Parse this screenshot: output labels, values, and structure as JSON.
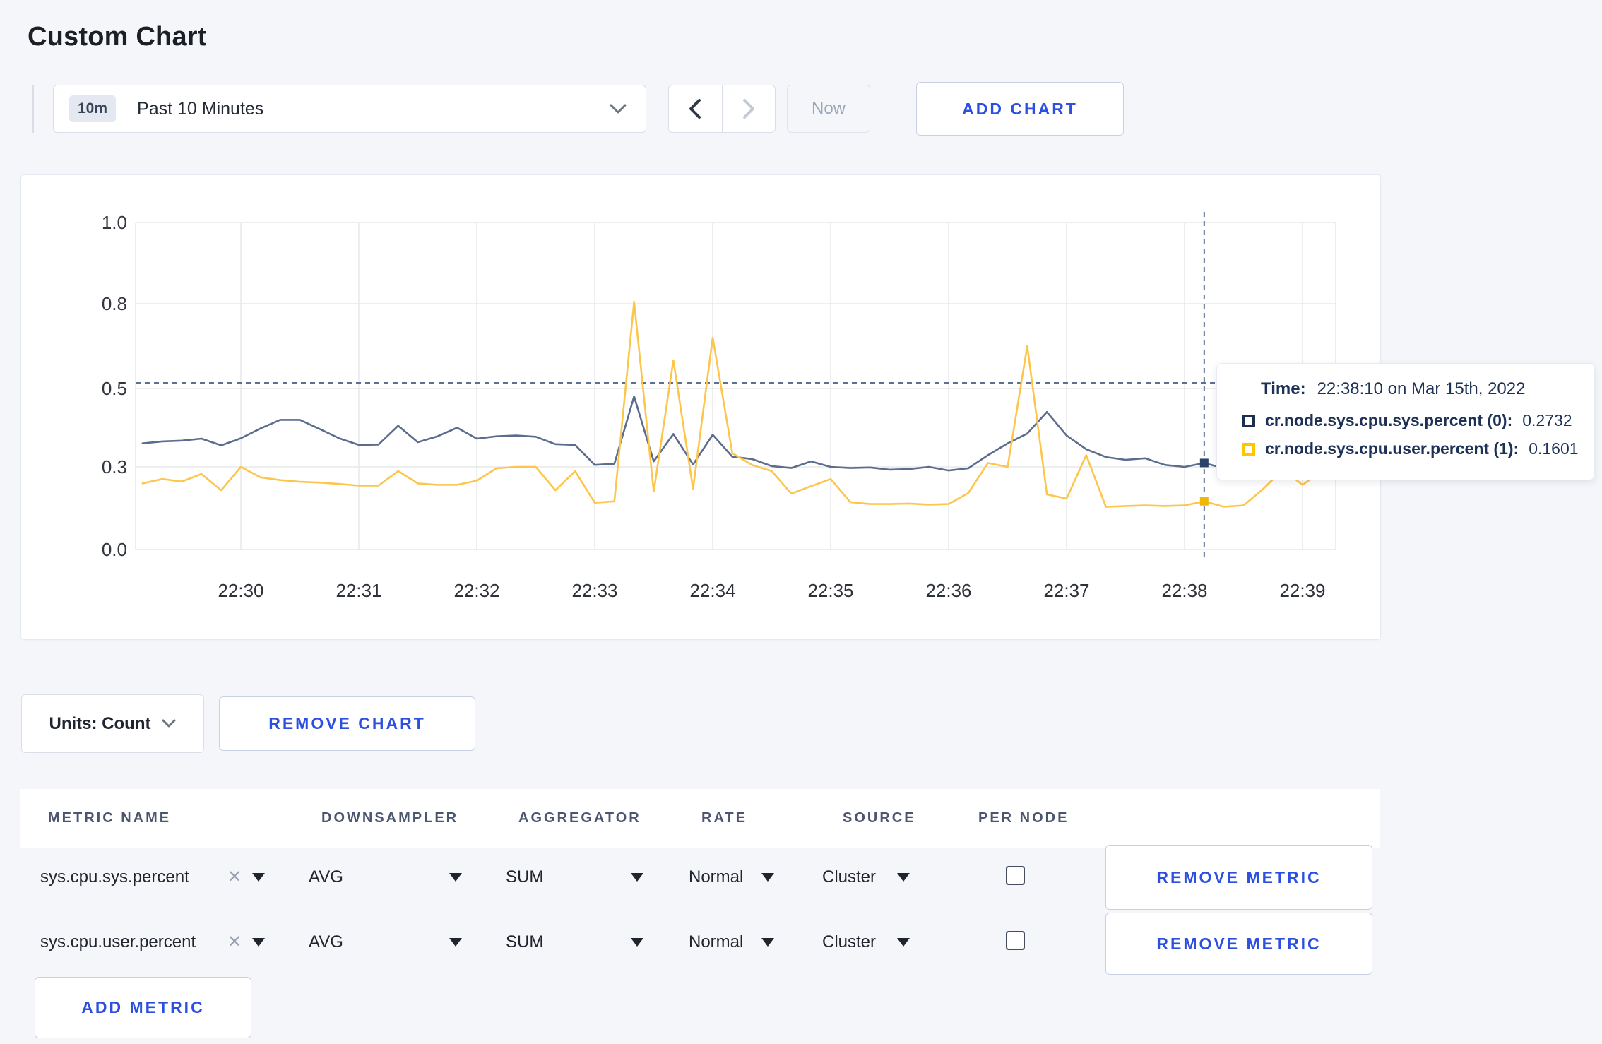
{
  "page": {
    "title": "Custom Chart"
  },
  "colors": {
    "accent_blue": "#2c4fe0",
    "page_background": "#f5f6fa",
    "gridline": "#e7e8ec",
    "crosshair": "#5c7191",
    "axis_text": "#33373f",
    "series_sys_line": "#5b6c8f",
    "series_user_line": "#fdc64b",
    "tooltip_sys_swatch": "#1c2e52",
    "tooltip_user_swatch": "#ffc600"
  },
  "toolbar": {
    "time_selector": {
      "badge": "10m",
      "label": "Past 10 Minutes"
    },
    "prev_icon": "chevron-left",
    "next_icon": "chevron-right",
    "now_label": "Now",
    "add_chart_label": "ADD CHART"
  },
  "chart_data": {
    "type": "line",
    "title": "",
    "xlabel": "",
    "ylabel": "",
    "x_start_time": "22:29:10",
    "x_step_seconds": 10,
    "x_tick_labels": [
      "22:30",
      "22:31",
      "22:32",
      "22:33",
      "22:34",
      "22:35",
      "22:36",
      "22:37",
      "22:38",
      "22:39"
    ],
    "y_tick_labels": [
      "0.0",
      "0.3",
      "0.5",
      "0.8",
      "1.0"
    ],
    "y_tick_values": [
      0.0,
      0.3,
      0.5,
      0.8,
      1.0
    ],
    "grid": true,
    "legend_position": "none",
    "series": [
      {
        "name": "cr.node.sys.cpu.sys.percent (0)",
        "color": "#5b6c8f",
        "values": [
          0.36,
          0.365,
          0.367,
          0.372,
          0.355,
          0.373,
          0.398,
          0.42,
          0.42,
          0.397,
          0.373,
          0.356,
          0.357,
          0.405,
          0.363,
          0.378,
          0.4,
          0.372,
          0.378,
          0.38,
          0.377,
          0.358,
          0.356,
          0.305,
          0.308,
          0.48,
          0.314,
          0.384,
          0.306,
          0.382,
          0.326,
          0.32,
          0.302,
          0.296,
          0.314,
          0.3,
          0.296,
          0.298,
          0.29,
          0.292,
          0.3,
          0.287,
          0.295,
          0.33,
          0.36,
          0.385,
          0.44,
          0.38,
          0.345,
          0.325,
          0.318,
          0.322,
          0.305,
          0.3,
          0.31,
          0.295,
          0.3,
          0.29,
          0.3,
          0.295,
          0.3
        ]
      },
      {
        "name": "cr.node.sys.cpu.user.percent (1)",
        "color": "#fdc64b",
        "values": [
          0.24,
          0.256,
          0.247,
          0.274,
          0.215,
          0.3,
          0.262,
          0.252,
          0.246,
          0.243,
          0.238,
          0.232,
          0.232,
          0.285,
          0.24,
          0.235,
          0.235,
          0.25,
          0.295,
          0.3,
          0.3,
          0.215,
          0.285,
          0.17,
          0.175,
          0.805,
          0.21,
          0.6,
          0.22,
          0.68,
          0.335,
          0.305,
          0.285,
          0.203,
          0.23,
          0.256,
          0.172,
          0.165,
          0.165,
          0.167,
          0.163,
          0.165,
          0.205,
          0.31,
          0.3,
          0.65,
          0.2,
          0.185,
          0.33,
          0.155,
          0.158,
          0.16,
          0.158,
          0.16,
          0.175,
          0.155,
          0.16,
          0.22,
          0.29,
          0.235,
          0.285
        ]
      }
    ],
    "crosshair": {
      "time": "22:38:10",
      "h_line_value": 0.52,
      "dot_values": [
        0.31,
        0.175
      ],
      "dot_colors": [
        "#2c4266",
        "#f0b708"
      ]
    }
  },
  "tooltip": {
    "time_label": "Time:",
    "time_value": "22:38:10 on Mar 15th, 2022",
    "series": [
      {
        "name": "cr.node.sys.cpu.sys.percent (0):",
        "value": "0.2732",
        "swatch": "#1c2e52"
      },
      {
        "name": "cr.node.sys.cpu.user.percent (1):",
        "value": "0.1601",
        "swatch": "#ffc600"
      }
    ]
  },
  "units_bar": {
    "units_label": "Units: Count",
    "remove_chart_label": "REMOVE CHART"
  },
  "metrics_table": {
    "headers": [
      "METRIC NAME",
      "DOWNSAMPLER",
      "AGGREGATOR",
      "RATE",
      "SOURCE",
      "PER NODE"
    ],
    "rows": [
      {
        "metric": "sys.cpu.sys.percent",
        "downsampler": "AVG",
        "aggregator": "SUM",
        "rate": "Normal",
        "source": "Cluster",
        "per_node_checked": false,
        "remove_label": "REMOVE METRIC"
      },
      {
        "metric": "sys.cpu.user.percent",
        "downsampler": "AVG",
        "aggregator": "SUM",
        "rate": "Normal",
        "source": "Cluster",
        "per_node_checked": false,
        "remove_label": "REMOVE METRIC"
      }
    ],
    "add_metric_label": "ADD METRIC"
  }
}
